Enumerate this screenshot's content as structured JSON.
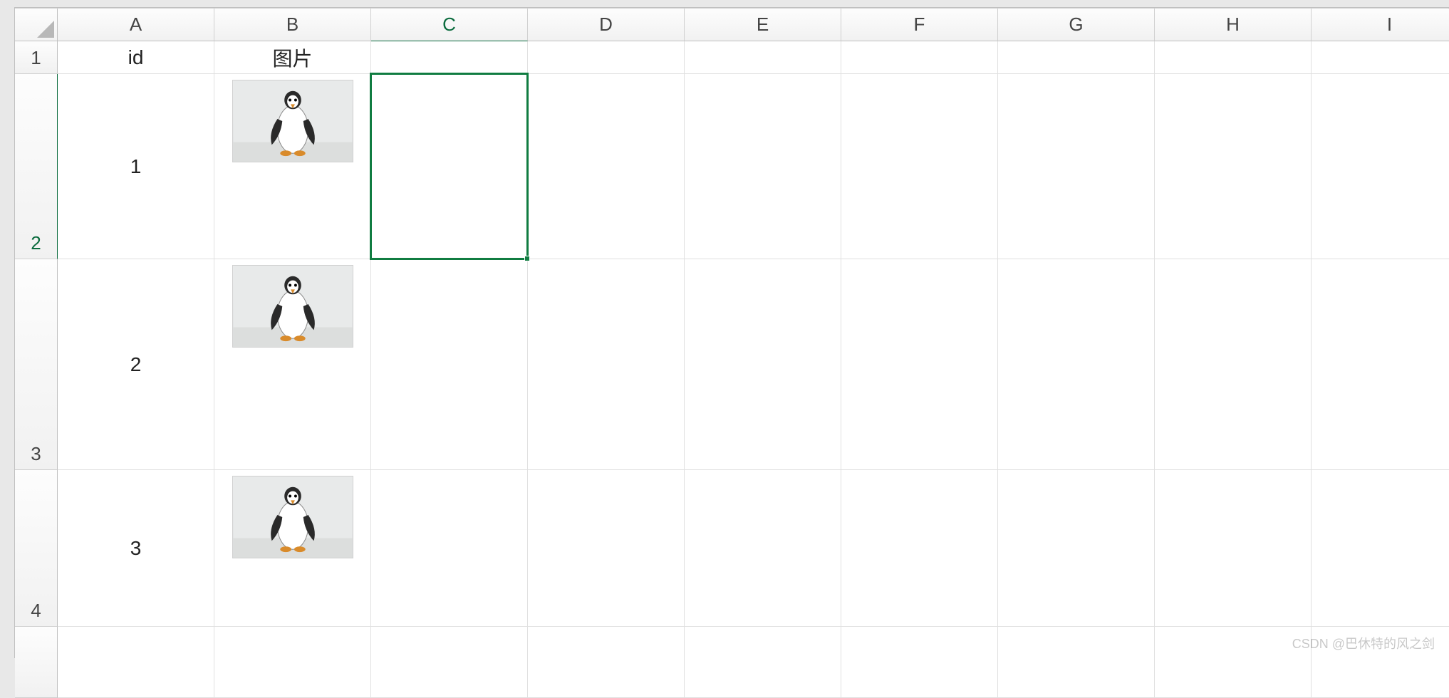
{
  "columns": [
    "A",
    "B",
    "C",
    "D",
    "E",
    "F",
    "G",
    "H",
    "I"
  ],
  "rowsVisible": [
    "1",
    "2",
    "3",
    "4"
  ],
  "headerRow": {
    "A": "id",
    "B": "图片"
  },
  "dataRows": [
    {
      "row": "2",
      "id": "1",
      "imageLabel": "penguin-image"
    },
    {
      "row": "3",
      "id": "2",
      "imageLabel": "penguin-image"
    },
    {
      "row": "4",
      "id": "3",
      "imageLabel": "penguin-image"
    }
  ],
  "selection": {
    "cell": "C2"
  },
  "watermark": "CSDN @巴休特的风之剑",
  "colors": {
    "selectionBorder": "#107c41",
    "gridLine": "#e0e0e0",
    "headerBg": "#f3f3f3"
  }
}
